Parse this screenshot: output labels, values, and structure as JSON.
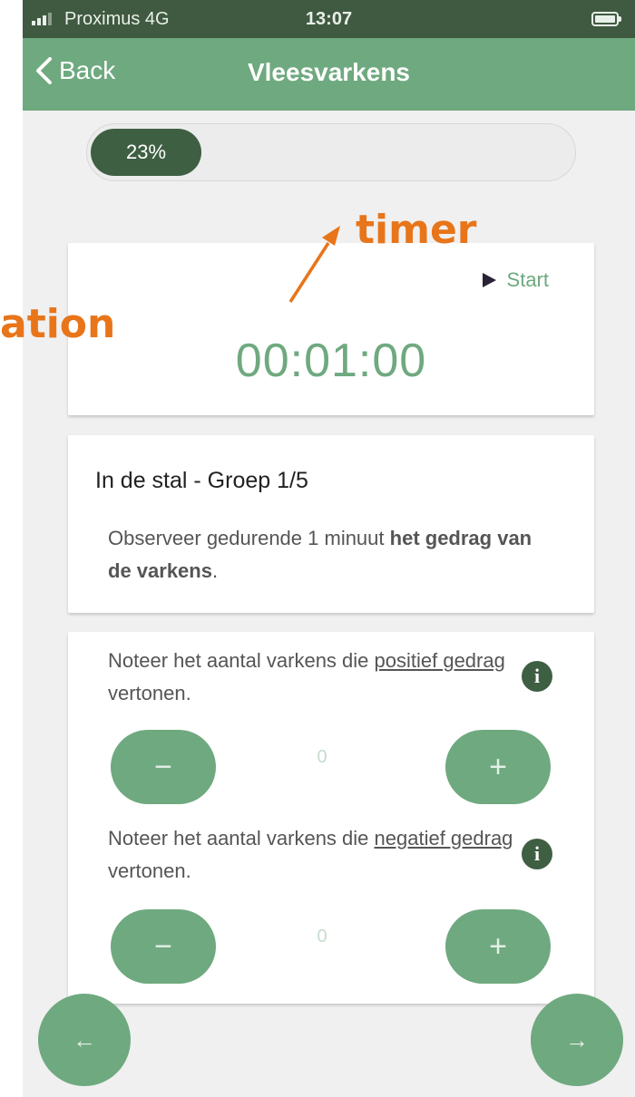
{
  "status_bar": {
    "carrier": "Proximus  4G",
    "time": "13:07"
  },
  "nav": {
    "back_label": "Back",
    "title": "Vleesvarkens"
  },
  "progress": {
    "label": "23%",
    "value": 0.23
  },
  "timer": {
    "start_label": "Start",
    "time": "00:01:00"
  },
  "info": {
    "heading": "In de stal - Groep 1/5",
    "desc_prefix": "Observeer gedurende 1 minuut ",
    "desc_bold": "het gedrag van de varkens",
    "desc_suffix": "."
  },
  "counters": [
    {
      "text_prefix": "Noteer het aantal varkens die ",
      "text_link": "positief gedrag",
      "text_suffix": " vertonen.",
      "value": "0",
      "minus": "−",
      "plus": "+"
    },
    {
      "text_prefix": "Noteer het aantal varkens die ",
      "text_link": "negatief gedrag",
      "text_suffix": " vertonen.",
      "value": "0",
      "minus": "−",
      "plus": "+"
    }
  ],
  "info_icon_glyph": "i",
  "bottom_nav": {
    "prev": "←",
    "next": "→"
  },
  "annotations": {
    "timer": "timer",
    "left": "ation"
  },
  "colors": {
    "accent": "#6fa97f",
    "dark_green": "#3f5f43",
    "annotation": "#e8751a"
  }
}
